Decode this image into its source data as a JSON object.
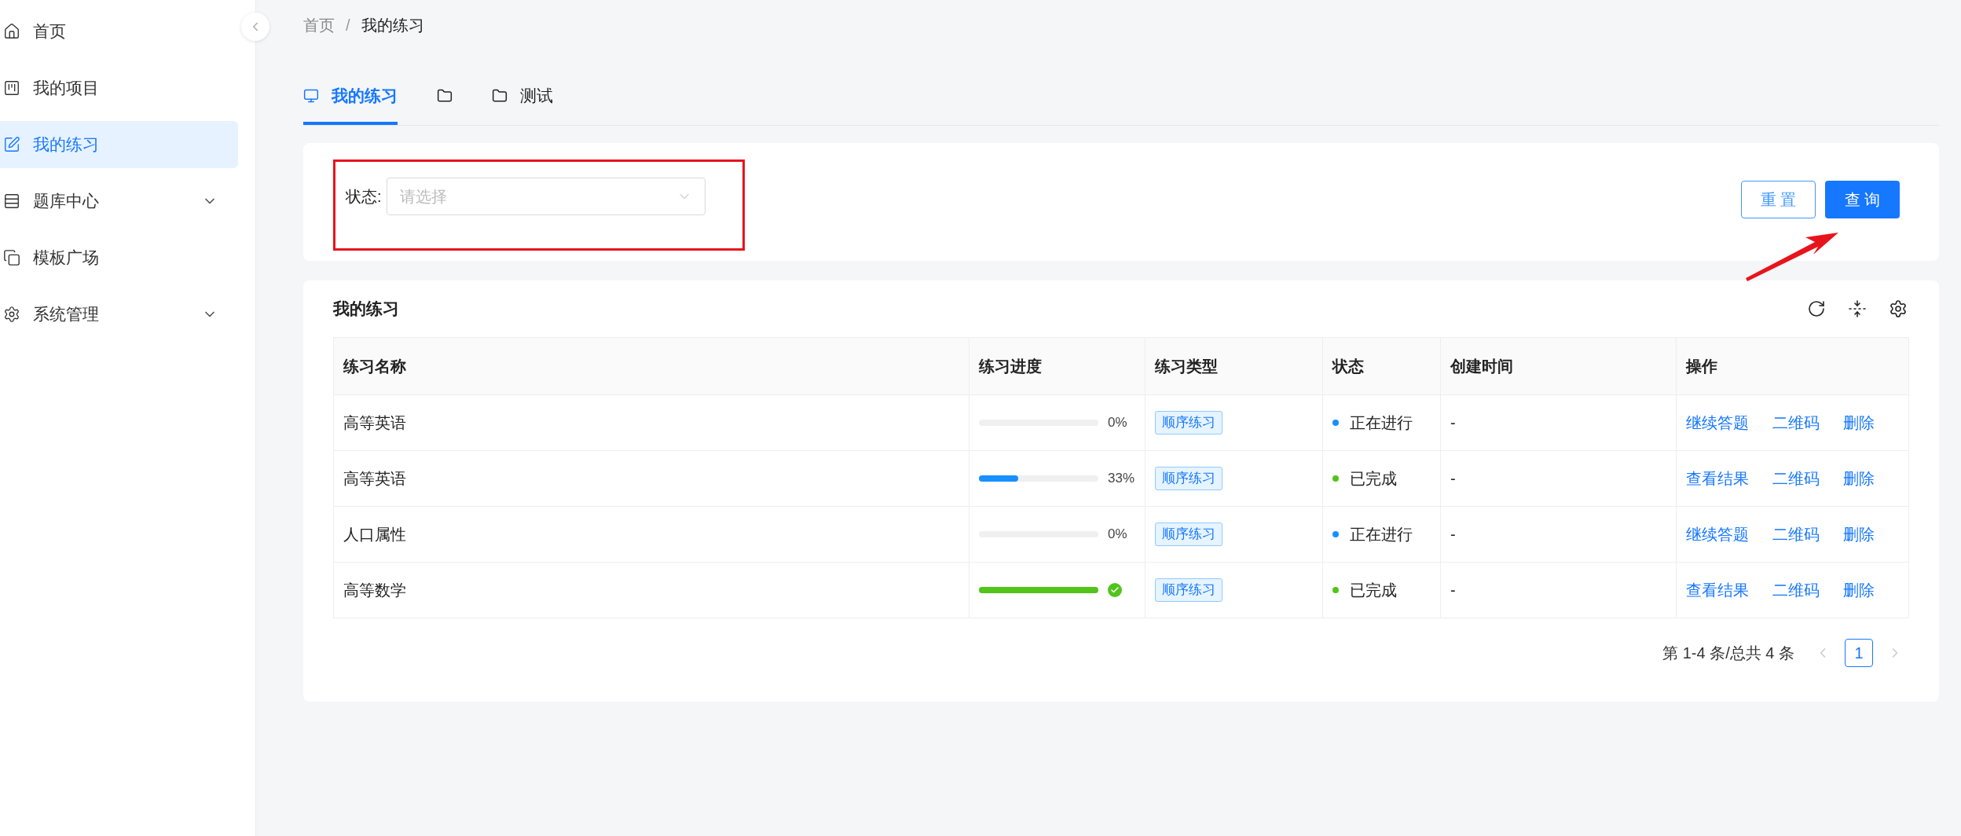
{
  "sidebar": {
    "items": [
      {
        "label": "首页",
        "selected": false
      },
      {
        "label": "我的项目",
        "selected": false
      },
      {
        "label": "我的练习",
        "selected": true
      },
      {
        "label": "题库中心",
        "selected": false,
        "expanded": false
      },
      {
        "label": "模板广场",
        "selected": false
      },
      {
        "label": "系统管理",
        "selected": false,
        "expanded": false
      }
    ]
  },
  "breadcrumb": {
    "items": [
      "首页",
      "我的练习"
    ],
    "separator": "/"
  },
  "tabs": [
    {
      "label": "我的练习",
      "selected": true
    },
    {
      "selected": false
    },
    {
      "label": "测试",
      "selected": false
    }
  ],
  "filter": {
    "label": "状态:",
    "placeholder": "请选择",
    "buttons": [
      {
        "kind": "default",
        "label": "重 置"
      },
      {
        "kind": "primary",
        "label": "查 询"
      }
    ]
  },
  "table": {
    "title": "我的练习",
    "columns": [
      "练习名称",
      "练习进度",
      "练习类型",
      "状态",
      "创建时间",
      "操作"
    ],
    "rows": [
      {
        "name": "高等英语",
        "progress": {
          "level": 0,
          "complete": false,
          "reading": "0%"
        },
        "type": "顺序练习",
        "status": {
          "label": "正在进行",
          "color": "#1890ff"
        },
        "created": "-",
        "actions": [
          "继续答题",
          "二维码",
          "删除"
        ]
      },
      {
        "name": "高等英语",
        "progress": {
          "level": 0.33,
          "complete": false,
          "reading": "33%"
        },
        "type": "顺序练习",
        "status": {
          "label": "已完成",
          "color": "#52c41a"
        },
        "created": "-",
        "actions": [
          "查看结果",
          "二维码",
          "删除"
        ]
      },
      {
        "name": "人口属性",
        "progress": {
          "level": 0,
          "complete": false,
          "reading": "0%"
        },
        "type": "顺序练习",
        "status": {
          "label": "正在进行",
          "color": "#1890ff"
        },
        "created": "-",
        "actions": [
          "继续答题",
          "二维码",
          "删除"
        ]
      },
      {
        "name": "高等数学",
        "progress": {
          "level": 1,
          "complete": true
        },
        "type": "顺序练习",
        "status": {
          "label": "已完成",
          "color": "#52c41a"
        },
        "created": "-",
        "actions": [
          "查看结果",
          "二维码",
          "删除"
        ]
      }
    ]
  },
  "pagination": {
    "summary": "第 1-4 条/总共 4 条",
    "pages": [
      {
        "label": "1",
        "selected": true
      }
    ]
  }
}
